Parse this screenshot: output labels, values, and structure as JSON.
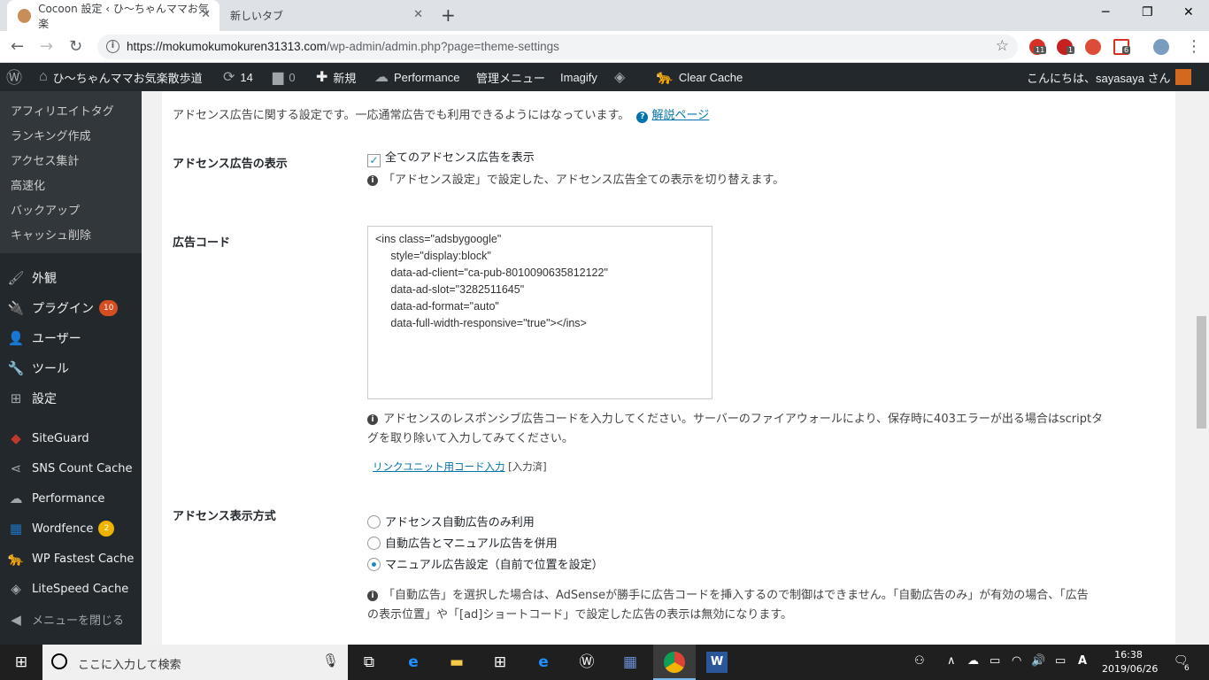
{
  "browser": {
    "tabs": [
      {
        "title": "Cocoon 設定 ‹ ひ〜ちゃんママお気楽",
        "active": true
      },
      {
        "title": "新しいタブ",
        "active": false
      }
    ],
    "new_tab_label": "+",
    "window_controls": {
      "minimize": "─",
      "restore": "❐",
      "close": "✕"
    },
    "url_host": "https://mokumokumokuren31313.com",
    "url_path": "/wp-admin/admin.php?page=theme-settings",
    "extensions": [
      {
        "name": "ext-1",
        "badge": "11",
        "color": "#d93025"
      },
      {
        "name": "adblock",
        "badge": "1",
        "color": "#c5221f"
      },
      {
        "name": "google-plus",
        "badge": "",
        "color": "#dd4b39"
      },
      {
        "name": "ext-r",
        "badge": "6",
        "color": "#ffffff"
      },
      {
        "name": "ext-img",
        "badge": "",
        "color": "#7a9cbf"
      },
      {
        "name": "avatar",
        "badge": "",
        "color": "#8fa8c8"
      }
    ]
  },
  "adminbar": {
    "site_name": "ひ〜ちゃんママお気楽散歩道",
    "updates": "14",
    "comments": "0",
    "new": "新規",
    "performance": "Performance",
    "admin_menu": "管理メニュー",
    "imagify": "Imagify",
    "clear_cache": "Clear Cache",
    "greeting": "こんにちは、sayasaya さん"
  },
  "sidebar": {
    "submenu": [
      "アフィリエイトタグ",
      "ランキング作成",
      "アクセス集計",
      "高速化",
      "バックアップ",
      "キャッシュ削除"
    ],
    "menu": [
      {
        "label": "外観",
        "icon": "brush-icon",
        "glyph": "🖌",
        "badge": ""
      },
      {
        "label": "プラグイン",
        "icon": "plug-icon",
        "glyph": "🔌",
        "badge": "10"
      },
      {
        "label": "ユーザー",
        "icon": "user-icon",
        "glyph": "👤",
        "badge": ""
      },
      {
        "label": "ツール",
        "icon": "wrench-icon",
        "glyph": "🔧",
        "badge": ""
      },
      {
        "label": "設定",
        "icon": "settings-icon",
        "glyph": "⊞",
        "badge": ""
      },
      {
        "label": "SiteGuard",
        "icon": "siteguard-icon",
        "glyph": "◆",
        "badge": ""
      },
      {
        "label": "SNS Count Cache",
        "icon": "share-icon",
        "glyph": "⋖",
        "badge": ""
      },
      {
        "label": "Performance",
        "icon": "performance-icon",
        "glyph": "☁",
        "badge": ""
      },
      {
        "label": "Wordfence",
        "icon": "wordfence-icon",
        "glyph": "▦",
        "badge": "2"
      },
      {
        "label": "WP Fastest Cache",
        "icon": "cheetah-icon",
        "glyph": "🐆",
        "badge": ""
      },
      {
        "label": "LiteSpeed Cache",
        "icon": "litespeed-icon",
        "glyph": "◈",
        "badge": ""
      },
      {
        "label": "メニューを閉じる",
        "icon": "collapse-icon",
        "glyph": "◀",
        "badge": ""
      }
    ]
  },
  "content": {
    "intro": "アドセンス広告に関する設定です。一応通常広告でも利用できるようにはなっています。",
    "help_link": "解説ページ",
    "display": {
      "label": "アドセンス広告の表示",
      "checkbox": "全てのアドセンス広告を表示",
      "checked": true,
      "note": "「アドセンス設定」で設定した、アドセンス広告全ての表示を切り替えます。"
    },
    "code": {
      "label": "広告コード",
      "value": "<ins class=\"adsbygoogle\"\n     style=\"display:block\"\n     data-ad-client=\"ca-pub-8010090635812122\"\n     data-ad-slot=\"3282511645\"\n     data-ad-format=\"auto\"\n     data-full-width-responsive=\"true\"></ins>",
      "note_line1": "アドセンスのレスポンシブ広告コードを入力してください。サーバーのファイアウォールにより、保存時に403エラーが出る場合はscriptタ",
      "note_line2": "グを取り除いて入力してみてください。",
      "link_unit": "リンクユニット用コード入力",
      "link_unit_status": "[入力済]"
    },
    "method": {
      "label": "アドセンス表示方式",
      "options": [
        "アドセンス自動広告のみ利用",
        "自動広告とマニュアル広告を併用",
        "マニュアル広告設定（自前で位置を設定）"
      ],
      "selected": 2,
      "note_line1": "「自動広告」を選択した場合は、AdSenseが勝手に広告コードを挿入するので制御はできません。「自動広告のみ」が有効の場合、「広告",
      "note_line2": "の表示位置」や「[ad]ショートコード」で設定した広告の表示は無効になります。"
    }
  },
  "taskbar": {
    "search_placeholder": "ここに入力して検索",
    "time": "16:38",
    "date": "2019/06/26",
    "notifications": "6",
    "ime": "A"
  }
}
